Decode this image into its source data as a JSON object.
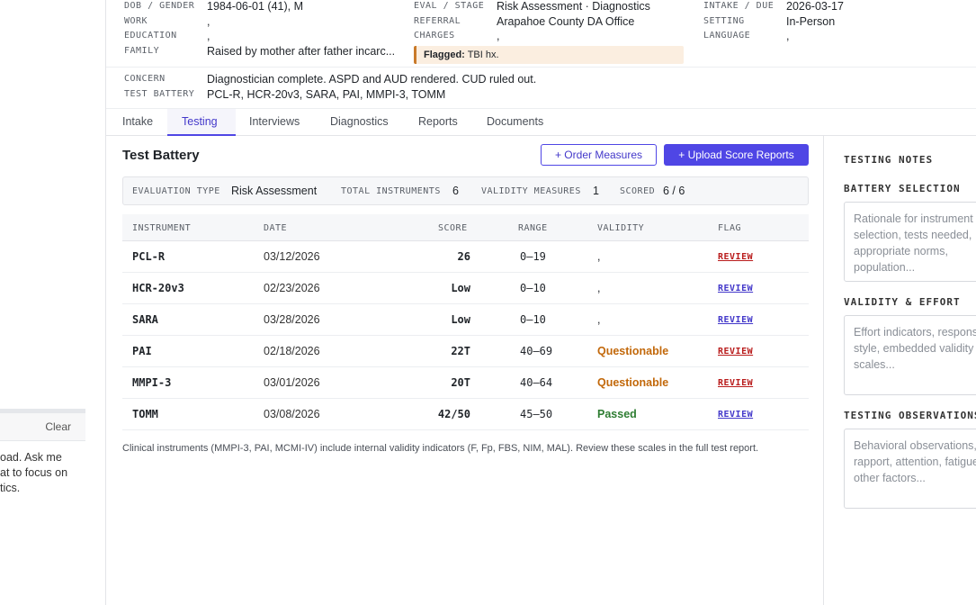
{
  "left_panel": {
    "clear_label": "Clear",
    "message_lines": [
      "oad. Ask me",
      "at to focus on",
      "tics."
    ]
  },
  "case_header": {
    "dob_gender": {
      "label": "DOB / GENDER",
      "value": "1984-06-01 (41), M"
    },
    "work": {
      "label": "WORK",
      "value": ","
    },
    "education": {
      "label": "EDUCATION",
      "value": ","
    },
    "family": {
      "label": "FAMILY",
      "value": "Raised by mother after father incarc..."
    },
    "eval_stage": {
      "label": "EVAL / STAGE",
      "value": "Risk Assessment · Diagnostics"
    },
    "referral": {
      "label": "REFERRAL",
      "value": "Arapahoe County DA Office"
    },
    "charges": {
      "label": "CHARGES",
      "value": ","
    },
    "flag": {
      "label": "Flagged:",
      "text": "TBI hx."
    },
    "intake_due": {
      "label": "INTAKE / DUE",
      "value": "2026-03-17"
    },
    "setting": {
      "label": "SETTING",
      "value": "In-Person"
    },
    "language": {
      "label": "LANGUAGE",
      "value": ","
    },
    "concern": {
      "label": "CONCERN",
      "value": "Diagnostician complete. ASPD and AUD rendered. CUD ruled out."
    },
    "test_battery": {
      "label": "TEST BATTERY",
      "value": "PCL-R, HCR-20v3, SARA, PAI, MMPI-3, TOMM"
    }
  },
  "tabs": [
    "Intake",
    "Testing",
    "Interviews",
    "Diagnostics",
    "Reports",
    "Documents"
  ],
  "active_tab": "Testing",
  "main": {
    "title": "Test Battery",
    "order_button": "+ Order Measures",
    "upload_button": "+ Upload Score Reports",
    "summary": {
      "eval_type_label": "EVALUATION TYPE",
      "eval_type_value": "Risk Assessment",
      "total_label": "TOTAL INSTRUMENTS",
      "total_value": "6",
      "validity_label": "VALIDITY MEASURES",
      "validity_value": "1",
      "scored_label": "SCORED",
      "scored_value": "6 / 6"
    },
    "columns": [
      "INSTRUMENT",
      "DATE",
      "SCORE",
      "RANGE",
      "VALIDITY",
      "FLAG"
    ],
    "rows": [
      {
        "instrument": "PCL-R",
        "date": "03/12/2026",
        "score": "26",
        "range": "0–19",
        "validity": ",",
        "validity_status": "none",
        "flag": "REVIEW",
        "flag_color": "#b91c1c"
      },
      {
        "instrument": "HCR-20v3",
        "date": "02/23/2026",
        "score": "Low",
        "range": "0–10",
        "validity": ",",
        "validity_status": "none",
        "flag": "REVIEW",
        "flag_color": "#4338ca"
      },
      {
        "instrument": "SARA",
        "date": "03/28/2026",
        "score": "Low",
        "range": "0–10",
        "validity": ",",
        "validity_status": "none",
        "flag": "REVIEW",
        "flag_color": "#4338ca"
      },
      {
        "instrument": "PAI",
        "date": "02/18/2026",
        "score": "22T",
        "range": "40–69",
        "validity": "Questionable",
        "validity_status": "questionable",
        "flag": "REVIEW",
        "flag_color": "#b91c1c"
      },
      {
        "instrument": "MMPI-3",
        "date": "03/01/2026",
        "score": "20T",
        "range": "40–64",
        "validity": "Questionable",
        "validity_status": "questionable",
        "flag": "REVIEW",
        "flag_color": "#b91c1c"
      },
      {
        "instrument": "TOMM",
        "date": "03/08/2026",
        "score": "42/50",
        "range": "45–50",
        "validity": "Passed",
        "validity_status": "passed",
        "flag": "REVIEW",
        "flag_color": "#4338ca"
      }
    ],
    "footnote": "Clinical instruments (MMPI-3, PAI, MCMI-IV) include internal validity indicators (F, Fp, FBS, NIM, MAL). Review these scales in the full test report."
  },
  "notes": {
    "heading": "TESTING NOTES",
    "sections": [
      {
        "title": "BATTERY SELECTION",
        "placeholder": "Rationale for instrument selection, tests needed, appropriate norms, population..."
      },
      {
        "title": "VALIDITY & EFFORT",
        "placeholder": "Effort indicators, response style, embedded validity scales..."
      },
      {
        "title": "TESTING OBSERVATIONS",
        "placeholder": "Behavioral observations, rapport, attention, fatigue, other factors..."
      }
    ]
  },
  "colors": {
    "accent": "#4f46e5",
    "flag_red": "#b91c1c",
    "questionable": "#c2680a",
    "passed": "#2e7d32",
    "flag_bg": "#fbeee0"
  }
}
